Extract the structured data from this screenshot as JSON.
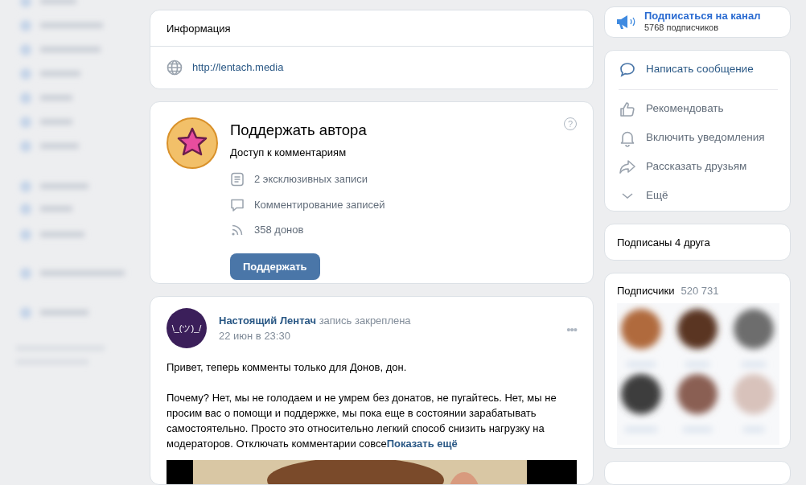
{
  "info": {
    "title": "Информация",
    "link": "http://lentach.media"
  },
  "donut": {
    "title": "Поддержать автора",
    "subtitle": "Доступ к комментариям",
    "features": [
      {
        "text": "2 эксклюзивных записи"
      },
      {
        "text": "Комментирование записей"
      },
      {
        "text": "358 донов"
      }
    ],
    "help": "?",
    "button": "Поддержать"
  },
  "post": {
    "avatar_text": "\\_(ツ)_/",
    "author": "Настоящий Лентач",
    "action": "запись закреплена",
    "date": "22 июн в 23:30",
    "menu": "•••",
    "paragraphs": [
      "Привет, теперь комменты только для Донов, дон.",
      "Почему? Нет, мы не голодаем и не умрем без донатов, не пугайтесь. Нет, мы не просим вас о помощи и поддержке, мы пока еще в состоянии зарабатывать самостоятельно. Просто это относительно легкий способ снизить нагрузку на модераторов. Отключать комментарии совсе"
    ],
    "more": "Показать ещё",
    "media": {
      "kind": "picture"
    }
  },
  "subscribe": {
    "title": "Подписаться на канал",
    "count": "5768 подписчиков"
  },
  "actions": [
    {
      "label": "Написать сообщение",
      "highlighted": true
    },
    {
      "label": "Рекомендовать",
      "highlighted": false
    },
    {
      "label": "Включить уведомления",
      "highlighted": false
    },
    {
      "label": "Рассказать друзьям",
      "highlighted": false
    },
    {
      "label": "Ещё",
      "highlighted": false
    }
  ],
  "friends": {
    "title": "Подписаны 4 друга"
  },
  "subscribers": {
    "title": "Подписчики",
    "count": "520 731"
  }
}
